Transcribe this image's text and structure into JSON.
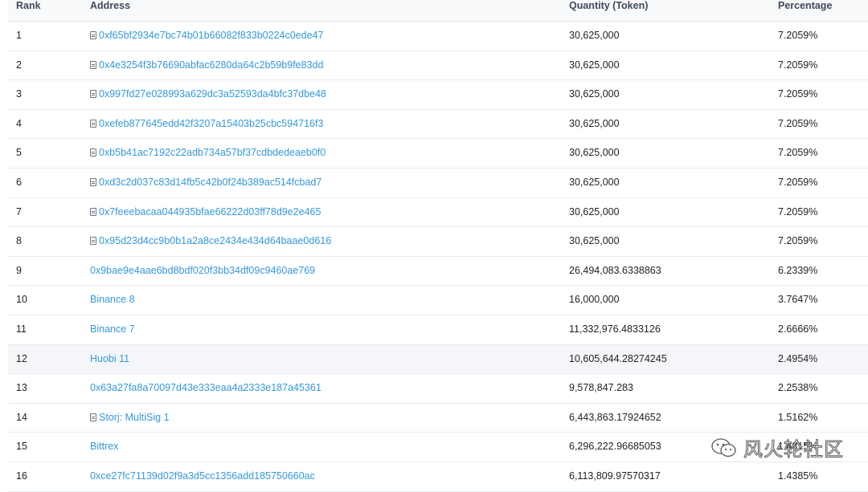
{
  "headers": {
    "rank": "Rank",
    "address": "Address",
    "quantity": "Quantity (Token)",
    "percentage": "Percentage"
  },
  "rows": [
    {
      "rank": "1",
      "address": "0xf65bf2934e7bc74b01b66082f833b0224c0ede47",
      "contract": true,
      "quantity": "30,625,000",
      "percentage": "7.2059%"
    },
    {
      "rank": "2",
      "address": "0x4e3254f3b76690abfac6280da64c2b59b9fe83dd",
      "contract": true,
      "quantity": "30,625,000",
      "percentage": "7.2059%"
    },
    {
      "rank": "3",
      "address": "0x997fd27e028993a629dc3a52593da4bfc37dbe48",
      "contract": true,
      "quantity": "30,625,000",
      "percentage": "7.2059%"
    },
    {
      "rank": "4",
      "address": "0xefeb877645edd42f3207a15403b25cbc594716f3",
      "contract": true,
      "quantity": "30,625,000",
      "percentage": "7.2059%"
    },
    {
      "rank": "5",
      "address": "0xb5b41ac7192c22adb734a57bf37cdbdedeaeb0f0",
      "contract": true,
      "quantity": "30,625,000",
      "percentage": "7.2059%"
    },
    {
      "rank": "6",
      "address": "0xd3c2d037c83d14fb5c42b0f24b389ac514fcbad7",
      "contract": true,
      "quantity": "30,625,000",
      "percentage": "7.2059%"
    },
    {
      "rank": "7",
      "address": "0x7feeebacaa044935bfae66222d03ff78d9e2e465",
      "contract": true,
      "quantity": "30,625,000",
      "percentage": "7.2059%"
    },
    {
      "rank": "8",
      "address": "0x95d23d4cc9b0b1a2a8ce2434e434d64baae0d616",
      "contract": true,
      "quantity": "30,625,000",
      "percentage": "7.2059%"
    },
    {
      "rank": "9",
      "address": "0x9bae9e4aae6bd8bdf020f3bb34df09c9460ae769",
      "contract": false,
      "quantity": "26,494,083.6338863",
      "percentage": "6.2339%"
    },
    {
      "rank": "10",
      "address": "Binance 8",
      "contract": false,
      "quantity": "16,000,000",
      "percentage": "3.7647%"
    },
    {
      "rank": "11",
      "address": "Binance 7",
      "contract": false,
      "quantity": "11,332,976.4833126",
      "percentage": "2.6666%"
    },
    {
      "rank": "12",
      "address": "Huobi 11",
      "contract": false,
      "quantity": "10,605,644.28274245",
      "percentage": "2.4954%",
      "highlight": true
    },
    {
      "rank": "13",
      "address": "0x63a27fa8a70097d43e333eaa4a2333e187a45361",
      "contract": false,
      "quantity": "9,578,847.283",
      "percentage": "2.2538%"
    },
    {
      "rank": "14",
      "address": "Storj: MultiSig 1",
      "contract": true,
      "quantity": "6,443,863.17924652",
      "percentage": "1.5162%"
    },
    {
      "rank": "15",
      "address": "Bittrex",
      "contract": false,
      "quantity": "6,296,222.96685053",
      "percentage": "1.4815%"
    },
    {
      "rank": "16",
      "address": "0xce27fc71139d02f9a3d5cc1356add185750660ac",
      "contract": false,
      "quantity": "6,113,809.97570317",
      "percentage": "1.4385%"
    }
  ],
  "watermark": {
    "text": "风火轮社区",
    "icon": "wechat-icon"
  }
}
